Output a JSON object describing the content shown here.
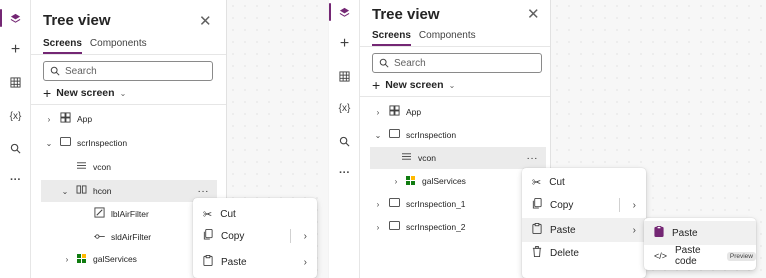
{
  "left": {
    "rail_icons": [
      "layers-icon",
      "plus-icon",
      "table-icon",
      "variables-icon",
      "search-icon",
      "more-icon"
    ],
    "rail_glyphs": {
      "variables": "{x}",
      "more": "···",
      "plus": "+"
    },
    "panel": {
      "title": "Tree view",
      "close": "✕",
      "tabs": [
        "Screens",
        "Components"
      ],
      "search_placeholder": "Search",
      "new_screen": "New screen",
      "nodes": [
        {
          "label": "App",
          "chevron": "›"
        },
        {
          "label": "scrInspection",
          "chevron": "⌄"
        },
        {
          "label": "vcon"
        },
        {
          "label": "hcon",
          "chevron": "⌄",
          "more": "···"
        },
        {
          "label": "lblAirFilter"
        },
        {
          "label": "sldAirFilter"
        },
        {
          "label": "galServices",
          "chevron": "›"
        }
      ]
    },
    "context_menu": {
      "items": [
        {
          "label": "Cut"
        },
        {
          "label": "Copy",
          "arrow": "›"
        },
        {
          "label": "Paste",
          "arrow": "›"
        }
      ]
    }
  },
  "right": {
    "rail_icons": [
      "layers-icon",
      "plus-icon",
      "table-icon",
      "variables-icon",
      "search-icon",
      "more-icon"
    ],
    "rail_glyphs": {
      "variables": "{x}",
      "more": "···",
      "plus": "+"
    },
    "panel": {
      "title": "Tree view",
      "close": "✕",
      "tabs": [
        "Screens",
        "Components"
      ],
      "search_placeholder": "Search",
      "new_screen": "New screen",
      "nodes": [
        {
          "label": "App",
          "chevron": "›"
        },
        {
          "label": "scrInspection",
          "chevron": "⌄"
        },
        {
          "label": "vcon",
          "more": "···"
        },
        {
          "label": "galServices",
          "chevron": "›"
        },
        {
          "label": "scrInspection_1",
          "chevron": "›"
        },
        {
          "label": "scrInspection_2",
          "chevron": "›"
        }
      ]
    },
    "context_menu": {
      "items": [
        {
          "label": "Cut"
        },
        {
          "label": "Copy",
          "arrow": "›"
        },
        {
          "label": "Paste",
          "arrow": "›"
        },
        {
          "label": "Delete"
        }
      ]
    },
    "submenu": {
      "items": [
        {
          "label": "Paste"
        },
        {
          "label": "Paste code",
          "badge": "Preview"
        }
      ]
    }
  },
  "colors": {
    "accent": "#742774",
    "gallery_green": "#107c10",
    "gallery_yellow": "#ffb900"
  }
}
